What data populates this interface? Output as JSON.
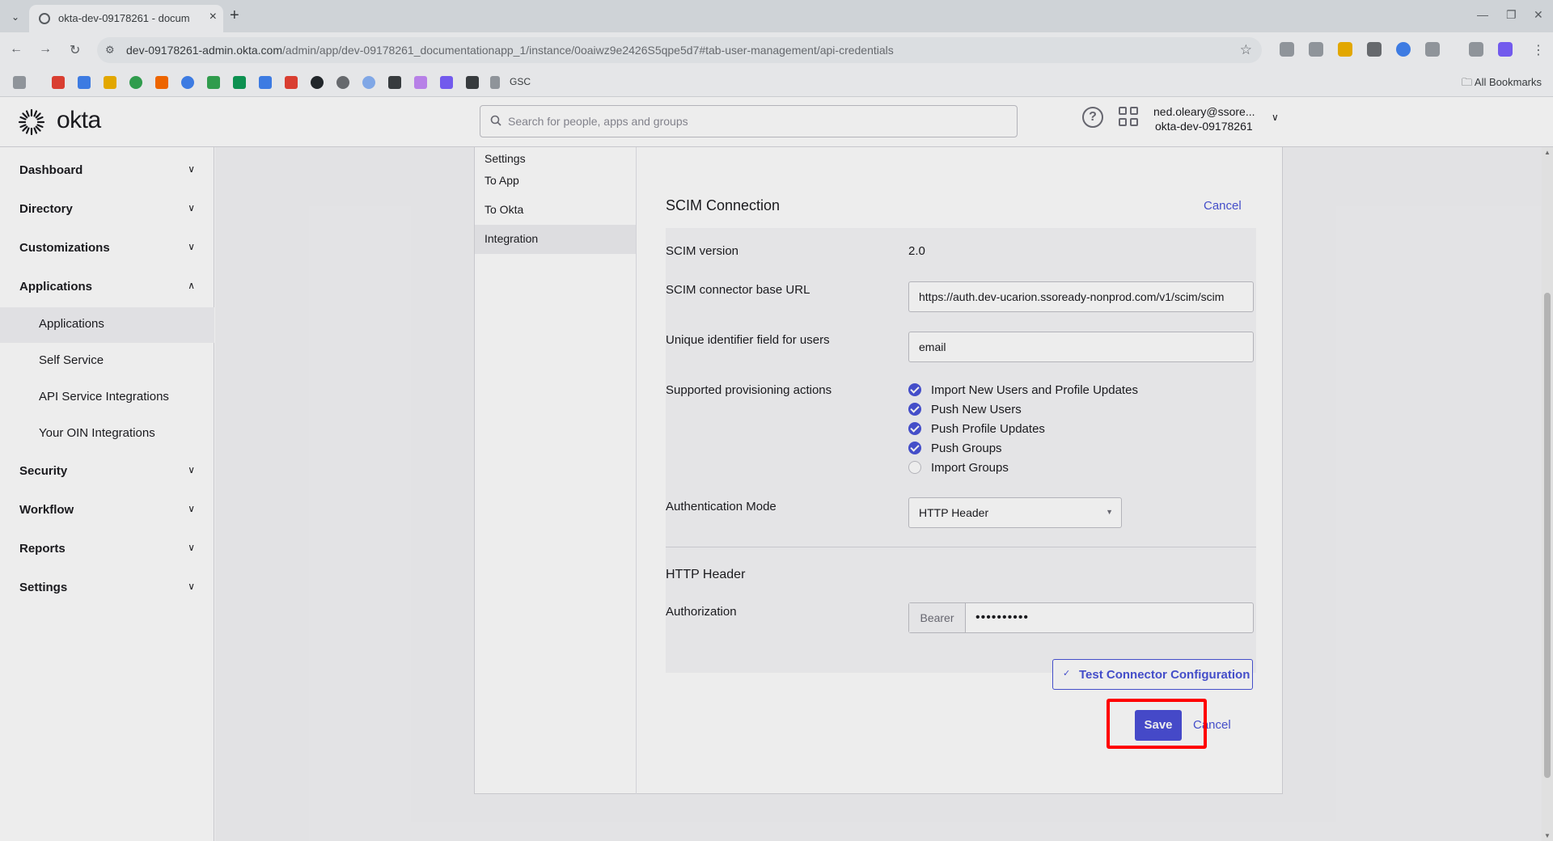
{
  "browser": {
    "tab_title": "okta-dev-09178261 - docum",
    "url_host": "dev-09178261-admin.okta.com",
    "url_path": "/admin/app/dev-09178261_documentationapp_1/instance/0oaiwz9e2426S5qpe5d7#tab-user-management/api-credentials",
    "bookmark_gsc": "GSC",
    "all_bookmarks": "All Bookmarks"
  },
  "header": {
    "logo": "okta",
    "search_placeholder": "Search for people, apps and groups",
    "user_name": "ned.oleary@ssore...",
    "user_org": "okta-dev-09178261"
  },
  "sidebar": {
    "sections": [
      {
        "label": "Dashboard",
        "expanded": false
      },
      {
        "label": "Directory",
        "expanded": false
      },
      {
        "label": "Customizations",
        "expanded": false
      },
      {
        "label": "Applications",
        "expanded": true
      },
      {
        "label": "Security",
        "expanded": false
      },
      {
        "label": "Workflow",
        "expanded": false
      },
      {
        "label": "Reports",
        "expanded": false
      },
      {
        "label": "Settings",
        "expanded": false
      }
    ],
    "app_items": [
      "Applications",
      "Self Service",
      "API Service Integrations",
      "Your OIN Integrations"
    ]
  },
  "subnav": {
    "header": "Settings",
    "items": [
      "To App",
      "To Okta",
      "Integration"
    ]
  },
  "form": {
    "title": "SCIM Connection",
    "cancel_top": "Cancel",
    "scim_version_label": "SCIM version",
    "scim_version_value": "2.0",
    "base_url_label": "SCIM connector base URL",
    "base_url_value": "https://auth.dev-ucarion.ssoready-nonprod.com/v1/scim/scim",
    "unique_id_label": "Unique identifier field for users",
    "unique_id_value": "email",
    "provisioning_label": "Supported provisioning actions",
    "provisioning_actions": [
      {
        "label": "Import New Users and Profile Updates",
        "checked": true
      },
      {
        "label": "Push New Users",
        "checked": true
      },
      {
        "label": "Push Profile Updates",
        "checked": true
      },
      {
        "label": "Push Groups",
        "checked": true
      },
      {
        "label": "Import Groups",
        "checked": false
      }
    ],
    "auth_mode_label": "Authentication Mode",
    "auth_mode_value": "HTTP Header",
    "http_header_title": "HTTP Header",
    "authorization_label": "Authorization",
    "bearer_prefix": "Bearer",
    "bearer_value": "••••••••••",
    "test_button": "Test Connector Configuration",
    "save_button": "Save",
    "cancel_bottom": "Cancel"
  },
  "colors": {
    "accent": "#4a54d9",
    "highlight": "#ff0000"
  }
}
